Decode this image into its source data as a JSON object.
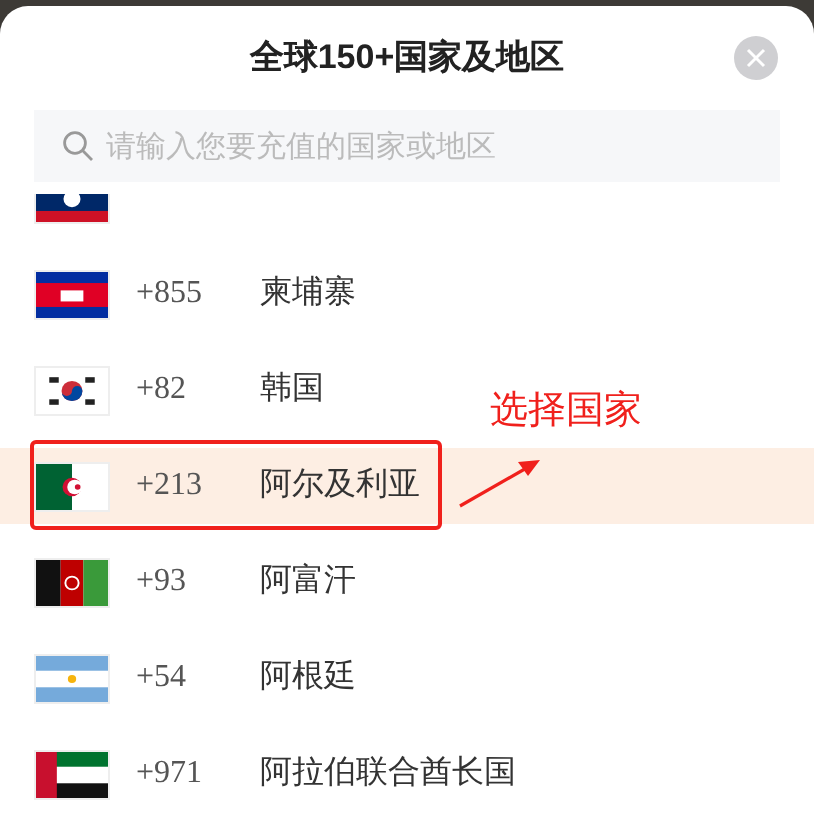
{
  "title": "全球150+国家及地区",
  "search": {
    "placeholder": "请输入您要充值的国家或地区"
  },
  "rows": [
    {
      "kind": "la",
      "selected": false,
      "marked": false
    },
    {
      "kind": "kh",
      "code": "+855",
      "name": "柬埔寨",
      "selected": false,
      "marked": false
    },
    {
      "kind": "kr",
      "code": "+82",
      "name": "韩国",
      "selected": false,
      "marked": false
    },
    {
      "kind": "dz",
      "code": "+213",
      "name": "阿尔及利亚",
      "selected": true,
      "marked": true
    },
    {
      "kind": "af",
      "code": "+93",
      "name": "阿富汗",
      "selected": false,
      "marked": false
    },
    {
      "kind": "ar",
      "code": "+54",
      "name": "阿根廷",
      "selected": false,
      "marked": false
    },
    {
      "kind": "ae",
      "code": "+971",
      "name": "阿拉伯联合酋长国",
      "selected": false,
      "marked": false
    }
  ],
  "annotation": {
    "label": "选择国家"
  }
}
